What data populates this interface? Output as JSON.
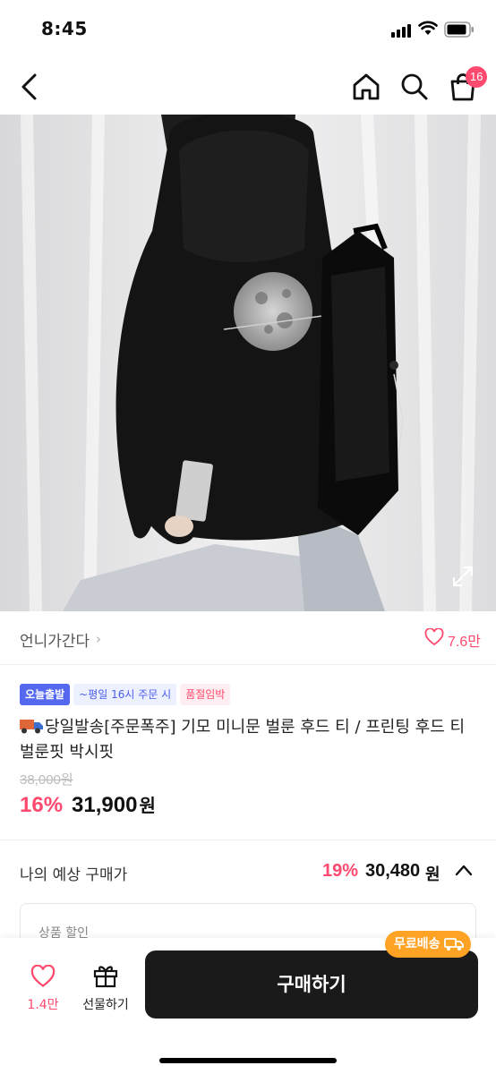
{
  "status_bar": {
    "time": "8:45"
  },
  "nav": {
    "cart_count": "16"
  },
  "hero": {
    "slide_count": 5,
    "active_slide": 1
  },
  "seller": {
    "name": "언니가간다",
    "chevron": "›",
    "likes": "7.6만"
  },
  "badges": {
    "today": "오늘출발",
    "time": "~평일 16시 주문 시",
    "sold": "품절임박"
  },
  "product": {
    "title": "당일발송[주문폭주] 기모 미니문 벌룬 후드 티 / 프린팅 후드 티 벌룬핏 박시핏",
    "original_price": "38,000원",
    "discount": "16%",
    "price": "31,900",
    "price_unit": "원"
  },
  "expected": {
    "label": "나의 예상 구매가",
    "discount": "19%",
    "price": "30,480",
    "price_unit": "원"
  },
  "discount_box": {
    "label": "상품 할인"
  },
  "bottom": {
    "wish_count": "1.4만",
    "gift_label": "선물하기",
    "buy_label": "구매하기",
    "free_shipping": "무료배송"
  },
  "colors": {
    "accent": "#ff4a6f",
    "badge_blue": "#5468f0",
    "shipping": "#ffa325",
    "buy_button": "#1a1a1a"
  },
  "icons": [
    "back-icon",
    "home-icon",
    "search-icon",
    "cart-icon",
    "expand-icon",
    "heart-icon",
    "truck-icon",
    "chevron-up-icon",
    "gift-icon"
  ]
}
